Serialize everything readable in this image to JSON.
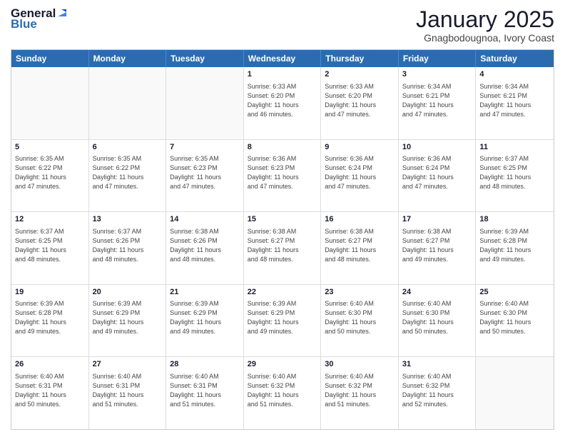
{
  "logo": {
    "general": "General",
    "blue": "Blue"
  },
  "title": "January 2025",
  "subtitle": "Gnagbodougnoa, Ivory Coast",
  "days": [
    "Sunday",
    "Monday",
    "Tuesday",
    "Wednesday",
    "Thursday",
    "Friday",
    "Saturday"
  ],
  "rows": [
    [
      {
        "day": "",
        "info": ""
      },
      {
        "day": "",
        "info": ""
      },
      {
        "day": "",
        "info": ""
      },
      {
        "day": "1",
        "info": "Sunrise: 6:33 AM\nSunset: 6:20 PM\nDaylight: 11 hours\nand 46 minutes."
      },
      {
        "day": "2",
        "info": "Sunrise: 6:33 AM\nSunset: 6:20 PM\nDaylight: 11 hours\nand 47 minutes."
      },
      {
        "day": "3",
        "info": "Sunrise: 6:34 AM\nSunset: 6:21 PM\nDaylight: 11 hours\nand 47 minutes."
      },
      {
        "day": "4",
        "info": "Sunrise: 6:34 AM\nSunset: 6:21 PM\nDaylight: 11 hours\nand 47 minutes."
      }
    ],
    [
      {
        "day": "5",
        "info": "Sunrise: 6:35 AM\nSunset: 6:22 PM\nDaylight: 11 hours\nand 47 minutes."
      },
      {
        "day": "6",
        "info": "Sunrise: 6:35 AM\nSunset: 6:22 PM\nDaylight: 11 hours\nand 47 minutes."
      },
      {
        "day": "7",
        "info": "Sunrise: 6:35 AM\nSunset: 6:23 PM\nDaylight: 11 hours\nand 47 minutes."
      },
      {
        "day": "8",
        "info": "Sunrise: 6:36 AM\nSunset: 6:23 PM\nDaylight: 11 hours\nand 47 minutes."
      },
      {
        "day": "9",
        "info": "Sunrise: 6:36 AM\nSunset: 6:24 PM\nDaylight: 11 hours\nand 47 minutes."
      },
      {
        "day": "10",
        "info": "Sunrise: 6:36 AM\nSunset: 6:24 PM\nDaylight: 11 hours\nand 47 minutes."
      },
      {
        "day": "11",
        "info": "Sunrise: 6:37 AM\nSunset: 6:25 PM\nDaylight: 11 hours\nand 48 minutes."
      }
    ],
    [
      {
        "day": "12",
        "info": "Sunrise: 6:37 AM\nSunset: 6:25 PM\nDaylight: 11 hours\nand 48 minutes."
      },
      {
        "day": "13",
        "info": "Sunrise: 6:37 AM\nSunset: 6:26 PM\nDaylight: 11 hours\nand 48 minutes."
      },
      {
        "day": "14",
        "info": "Sunrise: 6:38 AM\nSunset: 6:26 PM\nDaylight: 11 hours\nand 48 minutes."
      },
      {
        "day": "15",
        "info": "Sunrise: 6:38 AM\nSunset: 6:27 PM\nDaylight: 11 hours\nand 48 minutes."
      },
      {
        "day": "16",
        "info": "Sunrise: 6:38 AM\nSunset: 6:27 PM\nDaylight: 11 hours\nand 48 minutes."
      },
      {
        "day": "17",
        "info": "Sunrise: 6:38 AM\nSunset: 6:27 PM\nDaylight: 11 hours\nand 49 minutes."
      },
      {
        "day": "18",
        "info": "Sunrise: 6:39 AM\nSunset: 6:28 PM\nDaylight: 11 hours\nand 49 minutes."
      }
    ],
    [
      {
        "day": "19",
        "info": "Sunrise: 6:39 AM\nSunset: 6:28 PM\nDaylight: 11 hours\nand 49 minutes."
      },
      {
        "day": "20",
        "info": "Sunrise: 6:39 AM\nSunset: 6:29 PM\nDaylight: 11 hours\nand 49 minutes."
      },
      {
        "day": "21",
        "info": "Sunrise: 6:39 AM\nSunset: 6:29 PM\nDaylight: 11 hours\nand 49 minutes."
      },
      {
        "day": "22",
        "info": "Sunrise: 6:39 AM\nSunset: 6:29 PM\nDaylight: 11 hours\nand 49 minutes."
      },
      {
        "day": "23",
        "info": "Sunrise: 6:40 AM\nSunset: 6:30 PM\nDaylight: 11 hours\nand 50 minutes."
      },
      {
        "day": "24",
        "info": "Sunrise: 6:40 AM\nSunset: 6:30 PM\nDaylight: 11 hours\nand 50 minutes."
      },
      {
        "day": "25",
        "info": "Sunrise: 6:40 AM\nSunset: 6:30 PM\nDaylight: 11 hours\nand 50 minutes."
      }
    ],
    [
      {
        "day": "26",
        "info": "Sunrise: 6:40 AM\nSunset: 6:31 PM\nDaylight: 11 hours\nand 50 minutes."
      },
      {
        "day": "27",
        "info": "Sunrise: 6:40 AM\nSunset: 6:31 PM\nDaylight: 11 hours\nand 51 minutes."
      },
      {
        "day": "28",
        "info": "Sunrise: 6:40 AM\nSunset: 6:31 PM\nDaylight: 11 hours\nand 51 minutes."
      },
      {
        "day": "29",
        "info": "Sunrise: 6:40 AM\nSunset: 6:32 PM\nDaylight: 11 hours\nand 51 minutes."
      },
      {
        "day": "30",
        "info": "Sunrise: 6:40 AM\nSunset: 6:32 PM\nDaylight: 11 hours\nand 51 minutes."
      },
      {
        "day": "31",
        "info": "Sunrise: 6:40 AM\nSunset: 6:32 PM\nDaylight: 11 hours\nand 52 minutes."
      },
      {
        "day": "",
        "info": ""
      }
    ]
  ]
}
